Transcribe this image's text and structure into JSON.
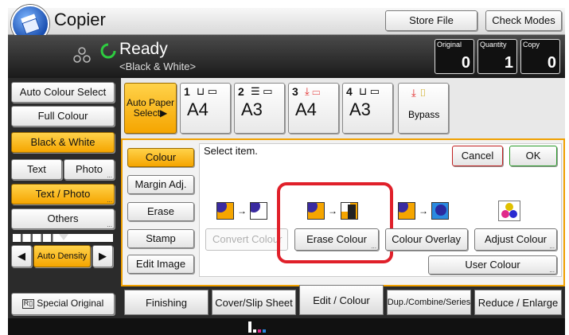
{
  "title": "Copier",
  "header_buttons": {
    "store_file": "Store File",
    "check_modes": "Check Modes"
  },
  "status": {
    "text": "Ready",
    "mode": "<Black & White>"
  },
  "counters": [
    {
      "label": "Original",
      "value": "0"
    },
    {
      "label": "Quantity",
      "value": "1"
    },
    {
      "label": "Copy",
      "value": "0"
    }
  ],
  "left_panel": {
    "auto_colour_select": "Auto Colour Select",
    "full_colour": "Full Colour",
    "black_white": "Black & White",
    "text": "Text",
    "photo": "Photo",
    "text_photo": "Text / Photo",
    "others": "Others",
    "auto_density": "Auto Density",
    "special_original": "Special Original",
    "special_original_icon": "document-icon"
  },
  "paper": {
    "auto_paper_select_line1": "Auto Paper",
    "auto_paper_select_line2": "Select▶",
    "trays": [
      {
        "tray": "1",
        "size": "A4"
      },
      {
        "tray": "2",
        "size": "A3"
      },
      {
        "tray": "3",
        "size": "A4"
      },
      {
        "tray": "4",
        "size": "A3"
      }
    ],
    "bypass": "Bypass"
  },
  "side_menu": {
    "colour": "Colour",
    "margin_adj": "Margin Adj.",
    "erase": "Erase",
    "stamp": "Stamp",
    "edit_image": "Edit Image"
  },
  "main": {
    "prompt": "Select item.",
    "cancel": "Cancel",
    "ok": "OK",
    "convert_colour": "Convert Colour",
    "erase_colour": "Erase Colour",
    "colour_overlay": "Colour Overlay",
    "adjust_colour": "Adjust Colour",
    "user_colour": "User Colour"
  },
  "tabs": {
    "finishing": "Finishing",
    "cover_slip_sheet": "Cover/Slip Sheet",
    "edit_colour": "Edit / Colour",
    "dup_combine_series": "Dup./Combine/Series",
    "reduce_enlarge": "Reduce / Enlarge"
  },
  "colors": {
    "accent": "#f5a500",
    "highlight_red": "#e0202a",
    "ok_green": "#2a9a2a",
    "cancel_red": "#c02020"
  }
}
